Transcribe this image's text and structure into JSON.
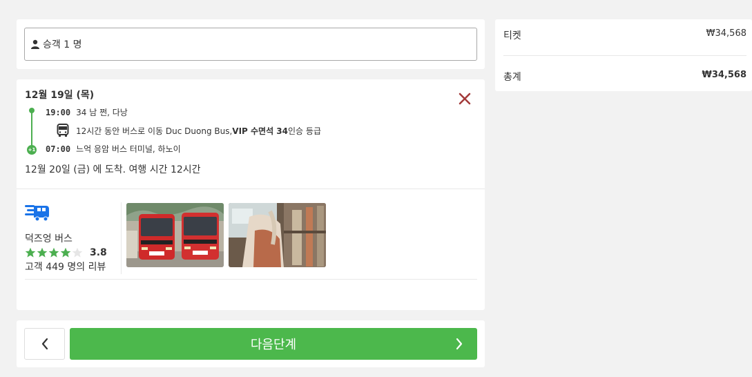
{
  "passengers": {
    "label": "승객 1 명"
  },
  "trip": {
    "date_title": "12월 19일 (목)",
    "departure": {
      "time": "19:00",
      "place": "34 남 쩐, 다낭"
    },
    "segment": {
      "text_prefix": "12시간 동안 버스로 이동 Duc Duong Bus, ",
      "bold": "VIP 수면석 34",
      "text_suffix": "인승 등급"
    },
    "next_day_badge": "+1",
    "arrival_stop": {
      "time": "07:00",
      "place": "느억 응암 버스 터미널, 하노이"
    },
    "arrival_summary": "12월 20일 (금) 에 도착. 여행 시간 12시간"
  },
  "operator": {
    "name": "덕즈엉 버스",
    "rating": 3.8,
    "rating_text": "3.8",
    "stars_filled": 4,
    "reviews": "고객 449 명의 리뷰",
    "accent_color": "#1a73e8"
  },
  "nav": {
    "next_label": "다음단계"
  },
  "summary": {
    "ticket_label": "티켓",
    "ticket_value": "₩34,568",
    "total_label": "총계",
    "total_value": "₩34,568"
  },
  "colors": {
    "primary_green": "#4cb84c",
    "close_red": "#a33a3a",
    "star_green": "#4caf50"
  }
}
